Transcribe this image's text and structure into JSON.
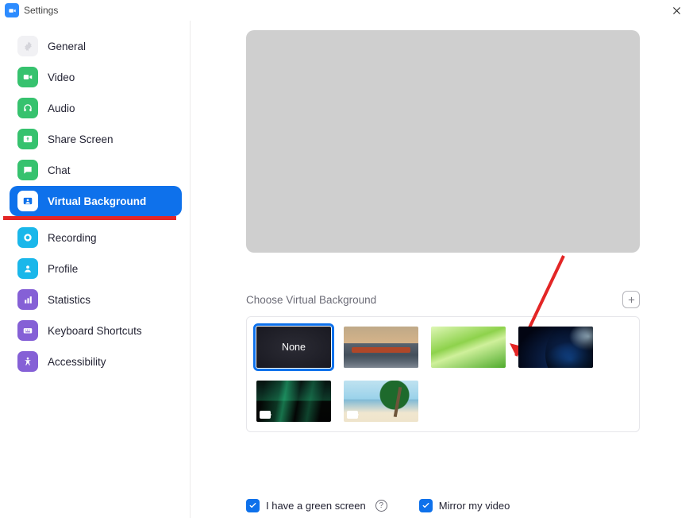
{
  "window": {
    "title": "Settings"
  },
  "sidebar": {
    "items": [
      {
        "label": "General"
      },
      {
        "label": "Video"
      },
      {
        "label": "Audio"
      },
      {
        "label": "Share Screen"
      },
      {
        "label": "Chat"
      },
      {
        "label": "Virtual Background"
      },
      {
        "label": "Recording"
      },
      {
        "label": "Profile"
      },
      {
        "label": "Statistics"
      },
      {
        "label": "Keyboard Shortcuts"
      },
      {
        "label": "Accessibility"
      }
    ],
    "active_index": 5
  },
  "main": {
    "section_title": "Choose Virtual Background",
    "none_label": "None",
    "checks": {
      "green_screen": "I have a green screen",
      "mirror": "Mirror my video"
    }
  },
  "colors": {
    "accent": "#0E71EB",
    "annotation": "#E32626"
  }
}
